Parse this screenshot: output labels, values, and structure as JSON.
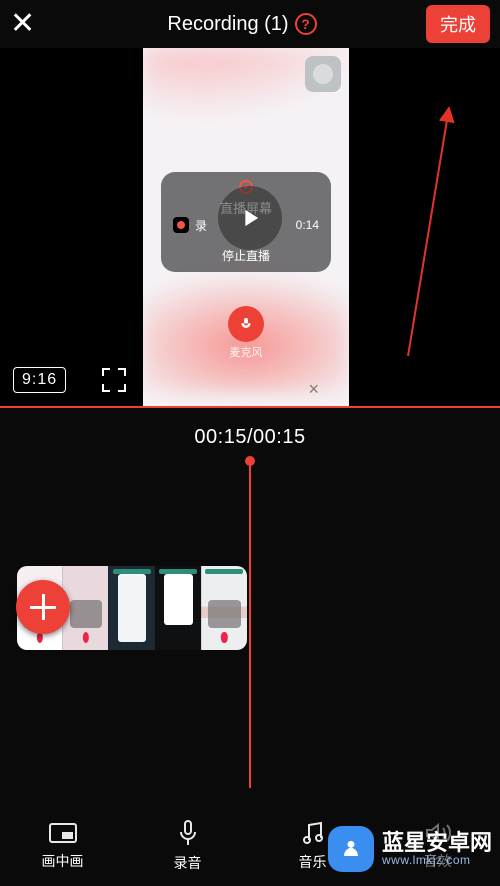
{
  "header": {
    "title": "Recording (1)",
    "help_glyph": "?",
    "close_glyph": "✕",
    "done_label": "完成"
  },
  "preview": {
    "aspect_label": "9:16",
    "rec_panel": {
      "title": "直播屏幕",
      "app_name": "录",
      "duration": "0:14",
      "stop_label": "停止直播"
    },
    "mic_label": "麦克风",
    "content_close_glyph": "×"
  },
  "timeline": {
    "time_display": "00:15/00:15"
  },
  "toolbar": {
    "pip_label": "画中画",
    "rec_audio_label": "录音",
    "music_label": "音乐",
    "bgm_label": "音效"
  },
  "watermark": {
    "brand": "蓝星安卓网",
    "url": "www.lmkjz.com"
  },
  "colors": {
    "accent": "#ed4036"
  }
}
